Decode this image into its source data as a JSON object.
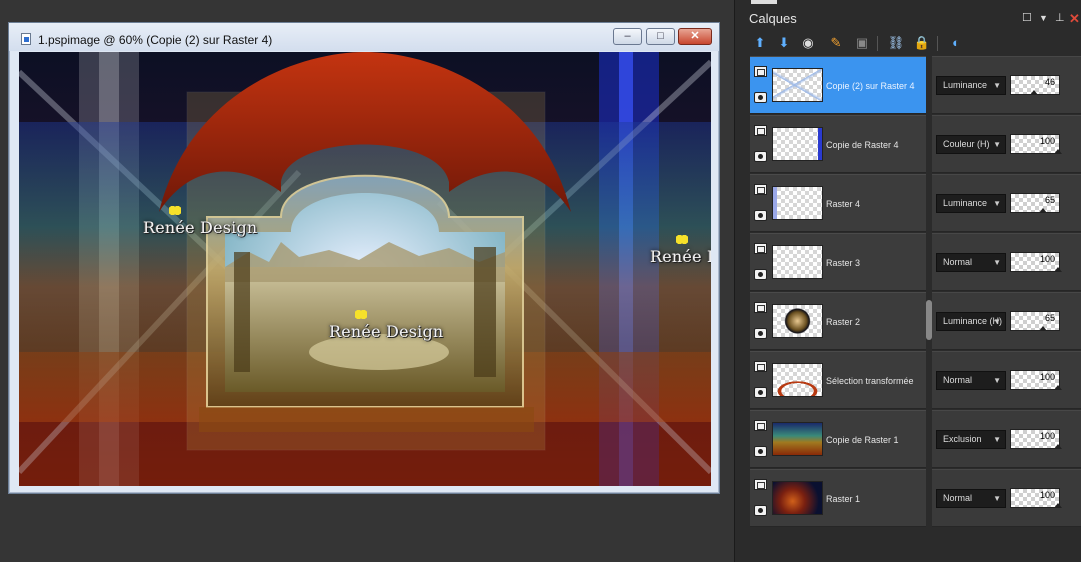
{
  "document": {
    "title": "1.pspimage @  60% (Copie (2) sur Raster 4)",
    "buttons": {
      "minimize": "–",
      "maximize": "□",
      "close": "✕"
    },
    "watermarks": [
      "Renée Design",
      "Renée Design",
      "Renée Design"
    ]
  },
  "panel": {
    "title": "Calques",
    "toolbar": [
      "new-raster-layer-icon",
      "new-vector-layer-icon",
      "new-mask-layer-icon",
      "effects-icon",
      "delete-icon",
      "link-icon",
      "lock-icon",
      "visibility-icon"
    ]
  },
  "layers": [
    {
      "name": "Copie (2) sur Raster 4",
      "blend": "Luminance",
      "opacity": "46",
      "active": true
    },
    {
      "name": "Copie de Raster 4",
      "blend": "Couleur (H)",
      "opacity": "100",
      "active": false
    },
    {
      "name": "Raster 4",
      "blend": "Luminance",
      "opacity": "65",
      "active": false
    },
    {
      "name": "Raster 3",
      "blend": "Normal",
      "opacity": "100",
      "active": false
    },
    {
      "name": "Raster 2",
      "blend": "Luminance (H)",
      "opacity": "65",
      "active": false
    },
    {
      "name": "Sélection transformée",
      "blend": "Normal",
      "opacity": "100",
      "active": false
    },
    {
      "name": "Copie de Raster 1",
      "blend": "Exclusion",
      "opacity": "100",
      "active": false
    },
    {
      "name": "Raster 1",
      "blend": "Normal",
      "opacity": "100",
      "active": false
    }
  ]
}
